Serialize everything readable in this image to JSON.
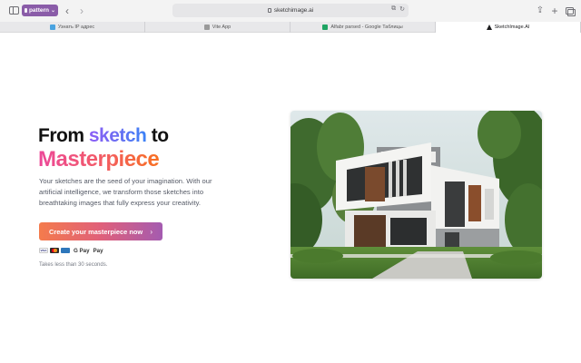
{
  "browser": {
    "profile_label": "pattern",
    "address": "sketchimage.ai",
    "tabs": [
      {
        "title": "Узнать IP адрес",
        "favicon": "ip-favicon-icon",
        "active": false
      },
      {
        "title": "Vite App",
        "favicon": "vite-favicon-icon",
        "active": false
      },
      {
        "title": "Alfabr parsed - Google Таблицы",
        "favicon": "sheets-favicon-icon",
        "active": false
      },
      {
        "title": "SketchImage.AI",
        "favicon": "sketchimage-favicon-icon",
        "active": true
      }
    ]
  },
  "hero": {
    "title_prefix": "From ",
    "title_highlight": "sketch",
    "title_suffix": " to",
    "title_line2": "Masterpiece",
    "description": "Your sketches are the seed of your imagination. With our artificial intelligence, we transform those sketches into breathtaking images that fully express your creativity.",
    "cta_label": "Create your masterpiece now",
    "cta_arrow": "›",
    "payment_methods": {
      "visa": "VISA",
      "gpay": "G Pay",
      "applepay": " Pay"
    },
    "note": "Takes less than 30 seconds."
  },
  "colors": {
    "sketch_gradient": [
      "#8b5cf6",
      "#3b82f6"
    ],
    "masterpiece_gradient": [
      "#ec4899",
      "#f97316"
    ],
    "cta_gradient": [
      "#f47b4c",
      "#a45bb0"
    ],
    "profile_pill": "#8a5ca8"
  }
}
